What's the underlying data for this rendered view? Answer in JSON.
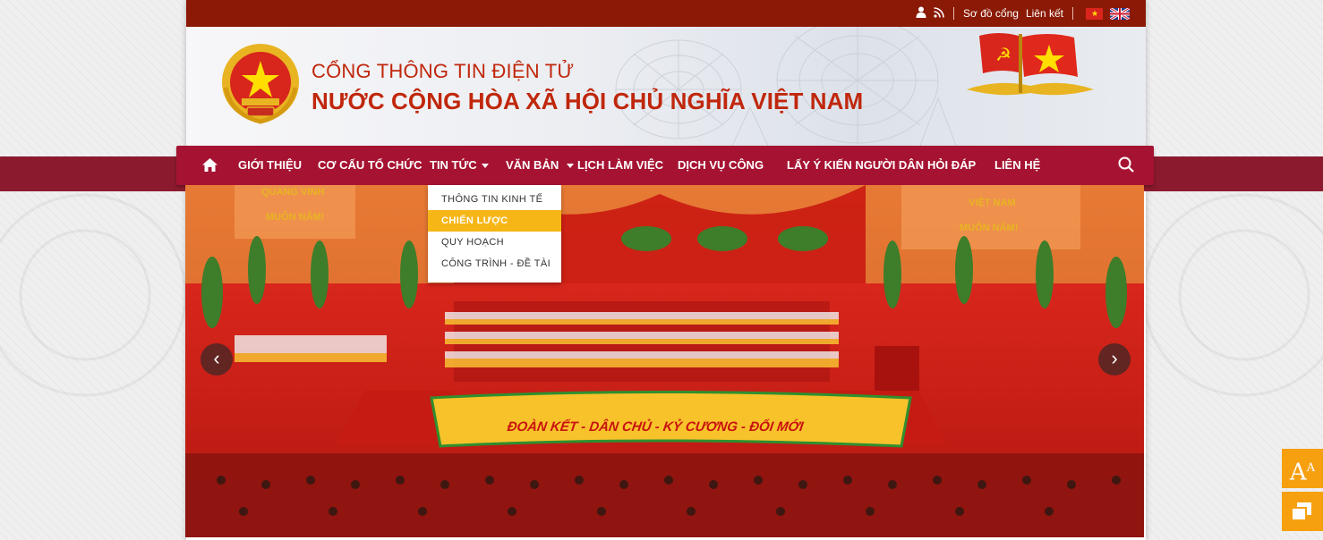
{
  "topbar": {
    "user_icon": "user-icon",
    "rss_icon": "rss-icon",
    "sitemap_label": "Sơ đồ cổng",
    "links_label": "Liên kết",
    "lang_vi_icon": "vietnam-flag-icon",
    "lang_en_icon": "uk-flag-icon"
  },
  "header": {
    "subtitle": "CỔNG THÔNG TIN ĐIỆN TỬ",
    "title": "NƯỚC CỘNG HÒA XÃ HỘI CHỦ NGHĨA VIỆT NAM",
    "emblem_icon": "national-emblem-icon",
    "flags_icon": "party-and-national-flags-icon"
  },
  "nav": {
    "home_icon": "home-icon",
    "items": [
      {
        "label": "GIỚI THIỆU"
      },
      {
        "label": "CƠ CẤU TỔ CHỨC"
      },
      {
        "label": "TIN TỨC"
      },
      {
        "label": "VĂN BẢN"
      },
      {
        "label": "LỊCH LÀM VIỆC"
      },
      {
        "label": "DỊCH VỤ CÔNG"
      },
      {
        "label": "LẤY Ý KIẾN NGƯỜI DÂN"
      },
      {
        "label": "HỎI ĐÁP"
      },
      {
        "label": "LIÊN HỆ"
      }
    ],
    "search_icon": "search-icon"
  },
  "dropdown": {
    "items": [
      {
        "label": "THÔNG TIN KINH TẾ"
      },
      {
        "label": "CHIẾN LƯỢC"
      },
      {
        "label": "QUY HOẠCH"
      },
      {
        "label": "CÔNG TRÌNH - ĐỀ TÀI"
      }
    ],
    "active_index": 1
  },
  "slider": {
    "banner_text": "ĐOÀN KẾT - DÂN CHỦ - KỶ CƯƠNG - ĐỔI MỚI",
    "left_board": [
      "QUANG VINH",
      "MUÔN NĂM!"
    ],
    "right_board": [
      "VIỆT NAM",
      "MUÔN NĂM!"
    ],
    "prev_icon": "chevron-left-icon",
    "next_icon": "chevron-right-icon"
  },
  "tools": {
    "font_size_icon": "font-size-icon",
    "contrast_icon": "contrast-icon"
  },
  "colors": {
    "topbar": "#8a1a05",
    "nav": "#a61332",
    "title": "#c0270c",
    "accent": "#f6b616"
  }
}
